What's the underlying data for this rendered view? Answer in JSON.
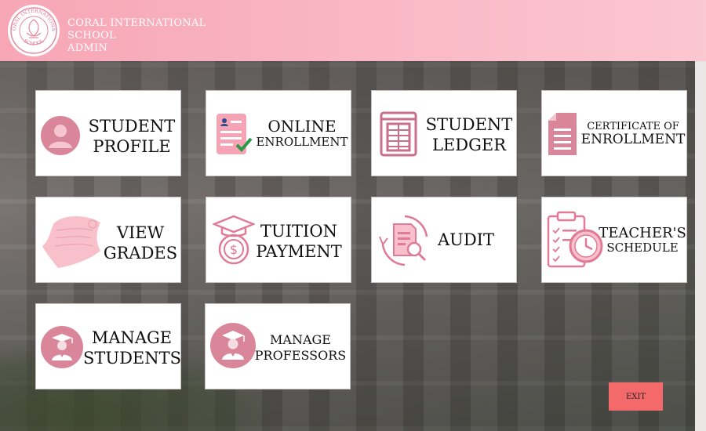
{
  "header": {
    "line1": "CORAL INTERNATIONAL",
    "line2": "SCHOOL",
    "line3": "ADMIN",
    "logo_text_top": "CORAL INTERNATIONAL",
    "logo_text_bottom": "SCHOOL"
  },
  "cards": {
    "student_profile": {
      "l1": "STUDENT",
      "l2": "PROFILE",
      "icon": "user-icon"
    },
    "online_enrollment": {
      "l1": "ONLINE",
      "l2": "ENROLLMENT",
      "icon": "form-check-icon"
    },
    "student_ledger": {
      "l1": "STUDENT",
      "l2": "LEDGER",
      "icon": "ledger-icon"
    },
    "certificate_enrollment": {
      "l1": "CERTIFICATE OF",
      "l2": "ENROLLMENT",
      "icon": "document-icon"
    },
    "view_grades": {
      "l1": "VIEW",
      "l2": "GRADES",
      "icon": "scroll-icon"
    },
    "tuition_payment": {
      "l1": "TUITION",
      "l2": "PAYMENT",
      "icon": "tuition-icon"
    },
    "audit": {
      "l1": "AUDIT",
      "icon": "audit-icon"
    },
    "teachers_schedule": {
      "l1": "TEACHER'S",
      "l2": "SCHEDULE",
      "icon": "schedule-icon"
    },
    "manage_students": {
      "l1": "MANAGE",
      "l2": "STUDENTS",
      "icon": "graduate-icon"
    },
    "manage_professors": {
      "l1": "MANAGE",
      "l2": "PROFESSORS",
      "icon": "professor-icon"
    }
  },
  "exit_label": "EXIT",
  "colors": {
    "accent": "#f7a6b6",
    "icon_pink": "#e07a96",
    "exit": "#f46a6a"
  }
}
